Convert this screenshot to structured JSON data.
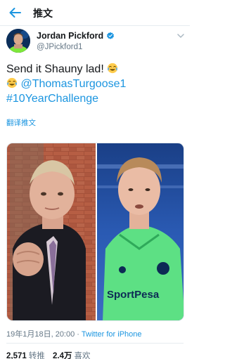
{
  "topbar": {
    "title": "推文"
  },
  "author": {
    "name": "Jordan Pickford",
    "handle": "@JPickford1"
  },
  "tweet": {
    "line1": "Send it Shauny lad! ",
    "mention": "@ThomasTurgoose1",
    "hashtag": "#10YearChallenge",
    "translate": "翻译推文"
  },
  "meta": {
    "timestamp": "19年1月18日, 20:00",
    "separator": "·",
    "source": "Twitter for iPhone"
  },
  "stats": {
    "retweets_count": "2,571",
    "retweets_label": "转推",
    "likes_count": "2.4万",
    "likes_label": "喜欢"
  },
  "colors": {
    "accent": "#1b95e0",
    "text": "#14171a",
    "muted": "#657786",
    "shirt_green": "#5de084"
  },
  "icons": [
    "back-arrow-icon",
    "verified-badge-icon",
    "chevron-down-icon",
    "face-with-tears-of-joy-emoji"
  ]
}
